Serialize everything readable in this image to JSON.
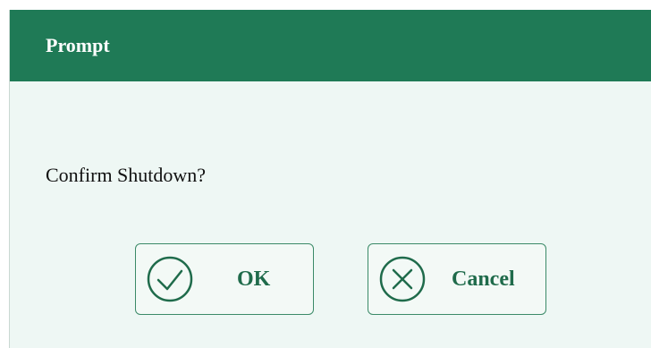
{
  "dialog": {
    "title": "Prompt",
    "message": "Confirm Shutdown?",
    "buttons": {
      "ok_label": "OK",
      "cancel_label": "Cancel"
    },
    "icons": {
      "ok": "check-circle-icon",
      "cancel": "x-circle-icon"
    },
    "colors": {
      "header_bg": "#1f7a56",
      "body_bg": "#eef7f4",
      "accent": "#1f6b4b"
    }
  }
}
